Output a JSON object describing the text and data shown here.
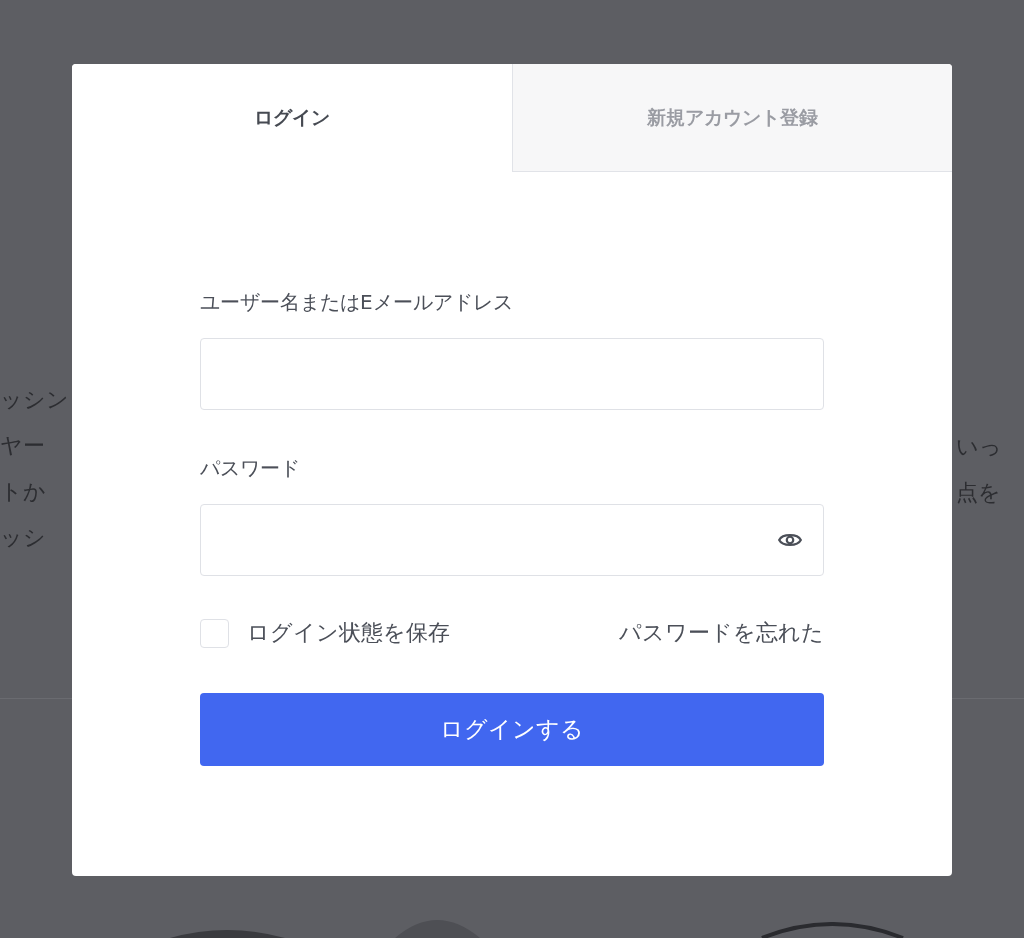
{
  "tabs": [
    {
      "label": "ログイン",
      "selected": true
    },
    {
      "label": "新規アカウント登録",
      "selected": false
    }
  ],
  "fields": [
    {
      "label": "ユーザー名またはEメールアドレス",
      "kind": "text"
    },
    {
      "label": "パスワード",
      "kind": "password"
    }
  ],
  "remember": {
    "label": "ログイン状態を保存",
    "checked": false
  },
  "forgot_link": "パスワードを忘れた",
  "submit": "ログインする",
  "background_text": {
    "left": [
      "ッシン",
      "ヤー",
      "トか",
      "ッシ"
    ],
    "right": [
      "いっ",
      "点を"
    ]
  }
}
